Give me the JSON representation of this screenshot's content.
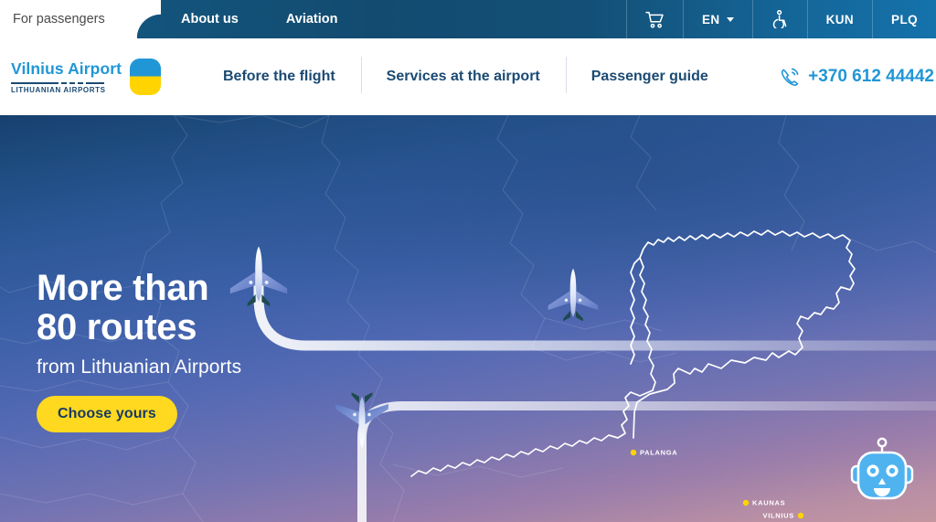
{
  "topbar": {
    "active_tab": "For passengers",
    "tabs": [
      "About us",
      "Aviation"
    ],
    "cart_icon": "shopping-cart-icon",
    "language": "EN",
    "accessibility_icon": "wheelchair-accessibility-icon",
    "airport_links": [
      "KUN",
      "PLQ"
    ]
  },
  "header": {
    "logo_name": "Vilnius Airport",
    "logo_sub": "LITHUANIAN AIRPORTS",
    "nav": [
      "Before the flight",
      "Services at the airport",
      "Passenger guide"
    ],
    "phone": "+370 612 44442",
    "phone_icon": "phone-call-icon"
  },
  "hero": {
    "title_line1": "More than",
    "title_line2": "80 routes",
    "subtitle": "from Lithuanian Airports",
    "cta_label": "Choose yours",
    "cities": [
      "PALANGA",
      "KAUNAS",
      "VILNIUS"
    ],
    "planes": 3
  },
  "chatbot": {
    "icon": "chatbot-robot-icon"
  },
  "colors": {
    "brand_blue": "#2196d6",
    "navy": "#1b4a73",
    "topbar_blue": "#134b70",
    "accent_yellow": "#ffd91f",
    "city_dot": "#ffd400",
    "white": "#ffffff"
  }
}
